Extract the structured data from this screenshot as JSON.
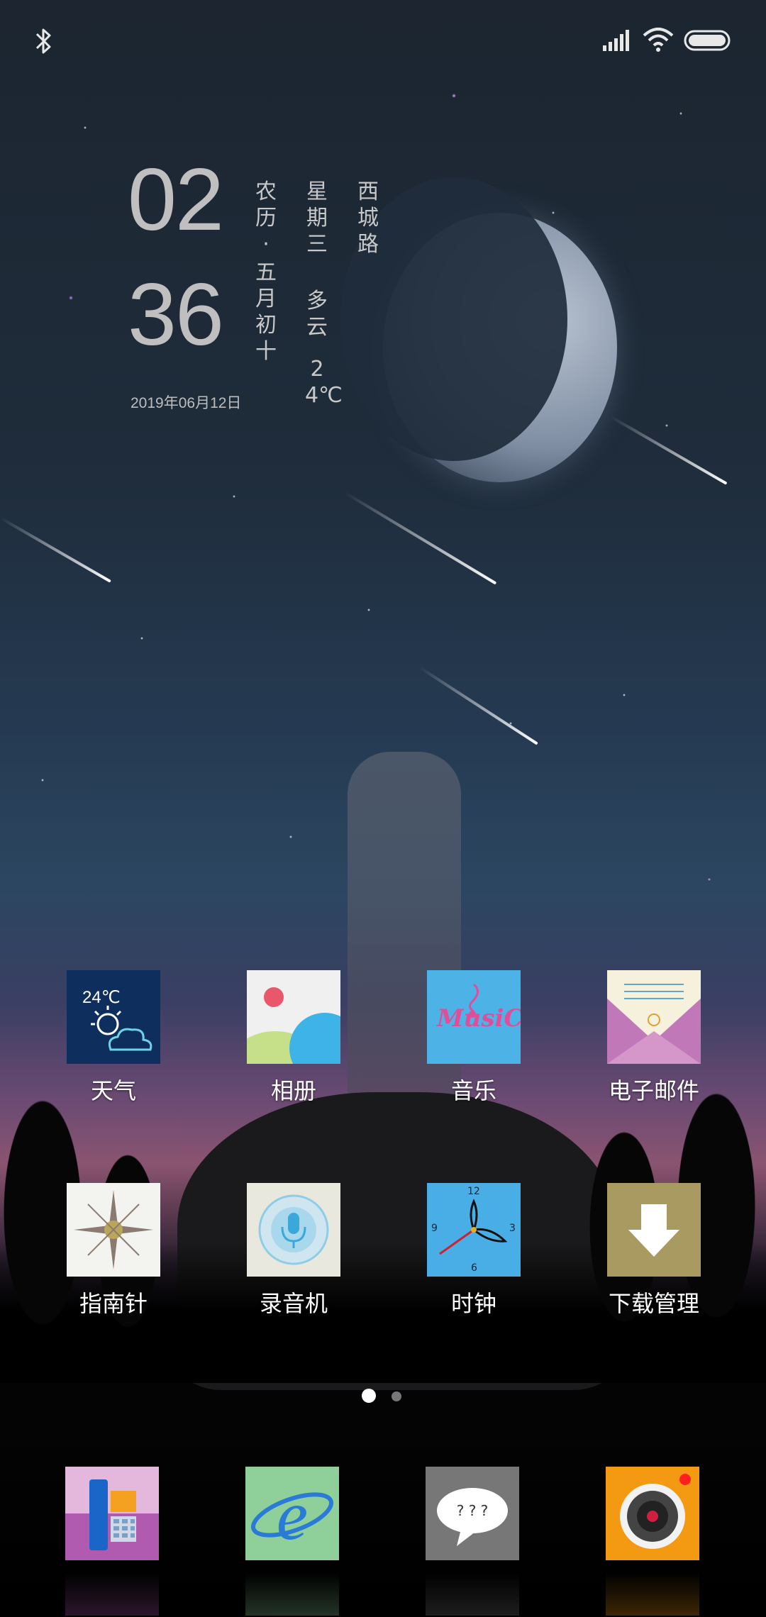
{
  "status_bar": {
    "icons": [
      "bluetooth-icon",
      "signal-icon",
      "wifi-icon",
      "battery-icon"
    ]
  },
  "clock_widget": {
    "hour": "02",
    "minute": "36",
    "lunar_label": "农历·",
    "lunar_date": "五月初十",
    "weekday": "星期三",
    "weather": "多云",
    "temperature": "24℃",
    "location": "西城路",
    "date": "2019年06月12日"
  },
  "apps": [
    {
      "label": "天气",
      "icon": "weather-icon",
      "temp": "24℃"
    },
    {
      "label": "相册",
      "icon": "gallery-icon"
    },
    {
      "label": "音乐",
      "icon": "music-icon",
      "text": "MusiC"
    },
    {
      "label": "电子邮件",
      "icon": "email-icon"
    },
    {
      "label": "指南针",
      "icon": "compass-icon"
    },
    {
      "label": "录音机",
      "icon": "recorder-icon"
    },
    {
      "label": "时钟",
      "icon": "clock-icon",
      "marks": [
        "12",
        "3",
        "6",
        "9"
      ]
    },
    {
      "label": "下载管理",
      "icon": "download-icon"
    }
  ],
  "page_indicator": {
    "pages": 2,
    "current": 1
  },
  "dock": [
    {
      "icon": "phone-icon"
    },
    {
      "icon": "browser-icon"
    },
    {
      "icon": "messages-icon",
      "text": "? ? ?"
    },
    {
      "icon": "camera-icon"
    }
  ],
  "colors": {
    "sky_top": "#1c2530",
    "horizon_pink": "#8a5470",
    "music_bg": "#4db3e6",
    "clock_bg": "#49aee6",
    "download_bg": "#a89a60",
    "camera_bg": "#f49a12"
  }
}
